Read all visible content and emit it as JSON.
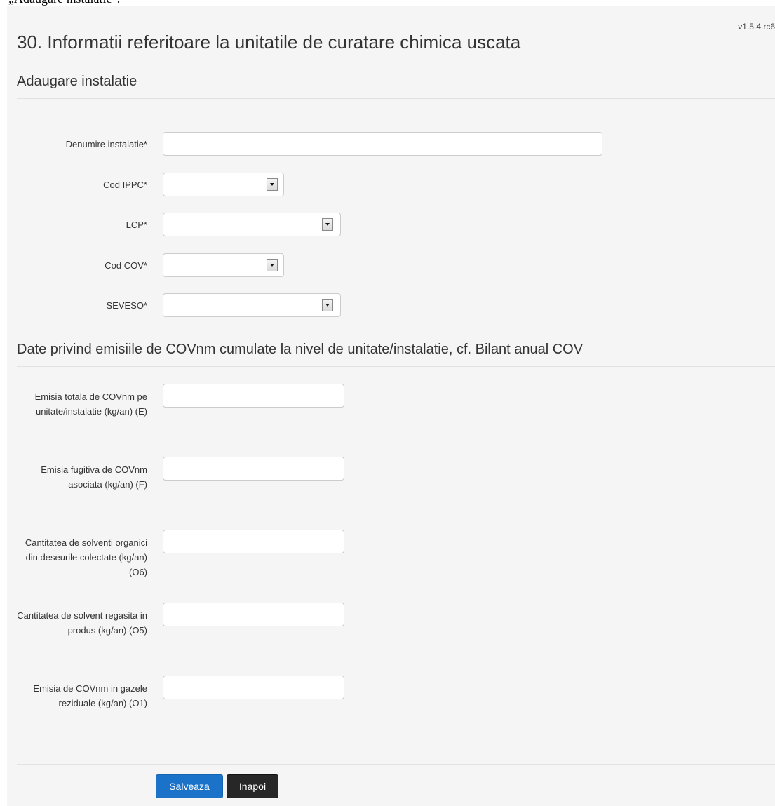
{
  "snippet_text": "„Adaugare instalatie\".",
  "version": "v1.5.4.rc6",
  "page_title": "30. Informatii referitoare la unitatile de curatare chimica uscata",
  "section_install": {
    "title": "Adaugare instalatie",
    "fields": {
      "denumire": {
        "label": "Denumire instalatie*",
        "value": ""
      },
      "cod_ippc": {
        "label": "Cod IPPC*",
        "value": ""
      },
      "lcp": {
        "label": "LCP*",
        "value": ""
      },
      "cod_cov": {
        "label": "Cod COV*",
        "value": ""
      },
      "seveso": {
        "label": "SEVESO*",
        "value": ""
      }
    }
  },
  "section_emissions": {
    "title": "Date privind emisiile de COVnm cumulate la nivel de unitate/instalatie, cf. Bilant anual COV",
    "fields": {
      "e": {
        "label": "Emisia totala de COVnm pe unitate/instalatie (kg/an) (E)",
        "value": ""
      },
      "f": {
        "label": "Emisia fugitiva de COVnm asociata (kg/an) (F)",
        "value": ""
      },
      "o6": {
        "label": "Cantitatea de solventi organici din deseurile colectate (kg/an) (O6)",
        "value": ""
      },
      "o5": {
        "label": "Cantitatea de solvent regasita in produs (kg/an) (O5)",
        "value": ""
      },
      "o1": {
        "label": "Emisia de COVnm in gazele reziduale (kg/an) (O1)",
        "value": ""
      }
    }
  },
  "buttons": {
    "save": "Salveaza",
    "back": "Inapoi"
  },
  "colors": {
    "primary_button": "#1a72c9",
    "dark_button": "#272727",
    "panel_background": "#f5f5f5"
  }
}
